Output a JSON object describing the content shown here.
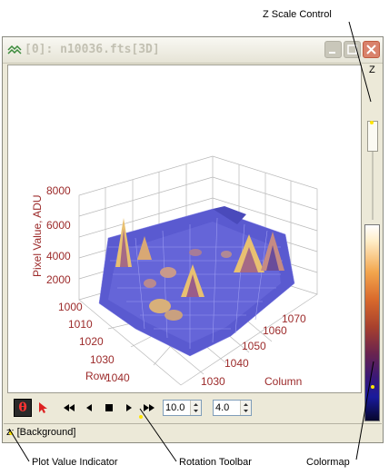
{
  "callouts": {
    "z_scale_control": "Z Scale Control",
    "plot_value_indicator": "Plot Value Indicator",
    "rotation_toolbar": "Rotation Toolbar",
    "colormap": "Colormap"
  },
  "window": {
    "title": "[0]: n10036.fts[3D]"
  },
  "zpanel": {
    "label": "Z"
  },
  "plot": {
    "z_axis_label": "Pixel Value, ADU",
    "z_ticks": [
      "8000",
      "6000",
      "4000",
      "2000"
    ],
    "row_label": "Row",
    "row_ticks": [
      "1000",
      "1010",
      "1020",
      "1030",
      "1040"
    ],
    "column_label": "Column",
    "column_ticks": [
      "1030",
      "1040",
      "1050",
      "1060",
      "1070"
    ]
  },
  "toolbar": {
    "theta_label": "θ",
    "angle1_value": "10.0",
    "angle2_value": "4.0"
  },
  "status": {
    "text": "z: [Background]"
  },
  "colors": {
    "axis_text": "#9c2a2a",
    "surface": "#5a5ad0",
    "peak": "#e8c071"
  },
  "icons": [
    "app-icon",
    "minimize-icon",
    "maximize-icon",
    "close-icon",
    "theta-icon",
    "pointer-icon",
    "rewind-icon",
    "step-back-icon",
    "stop-icon",
    "play-icon",
    "fast-forward-icon"
  ]
}
